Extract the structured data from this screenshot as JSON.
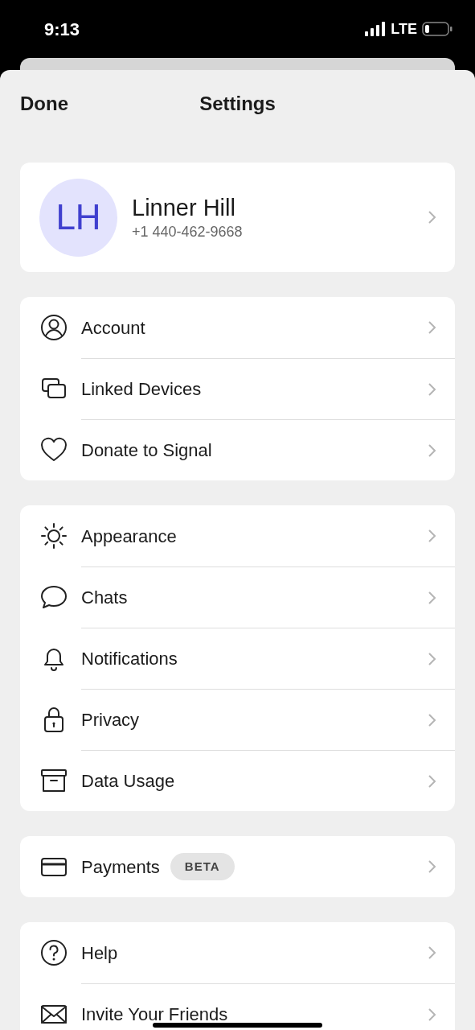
{
  "status_bar": {
    "time": "9:13",
    "network": "LTE"
  },
  "header": {
    "done": "Done",
    "title": "Settings"
  },
  "profile": {
    "initials": "LH",
    "name": "Linner Hill",
    "phone": "+1 440-462-9668"
  },
  "groups": [
    {
      "items": [
        {
          "label": "Account"
        },
        {
          "label": "Linked Devices"
        },
        {
          "label": "Donate to Signal"
        }
      ]
    },
    {
      "items": [
        {
          "label": "Appearance"
        },
        {
          "label": "Chats"
        },
        {
          "label": "Notifications"
        },
        {
          "label": "Privacy"
        },
        {
          "label": "Data Usage"
        }
      ]
    },
    {
      "items": [
        {
          "label": "Payments",
          "badge": "BETA"
        }
      ]
    },
    {
      "items": [
        {
          "label": "Help"
        },
        {
          "label": "Invite Your Friends"
        }
      ]
    }
  ]
}
